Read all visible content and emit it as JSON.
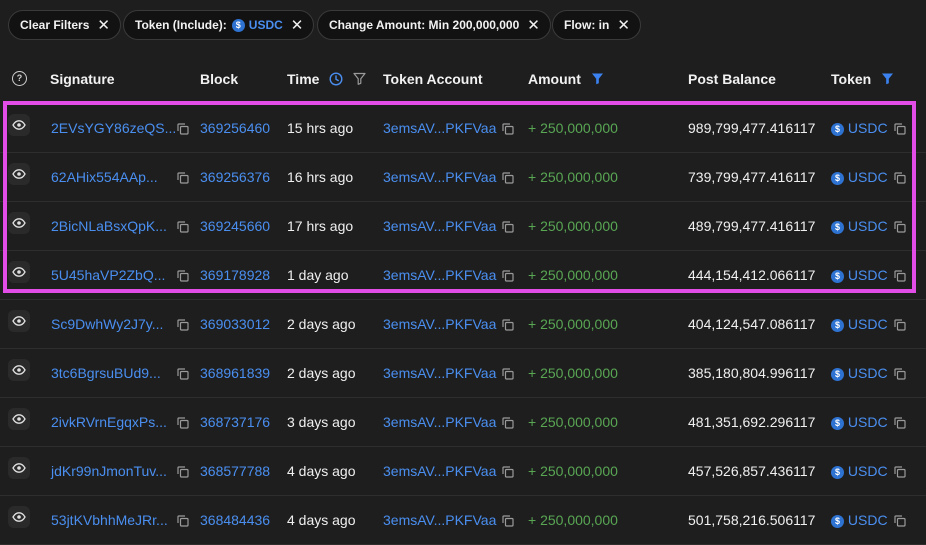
{
  "filters": {
    "clear": "Clear Filters",
    "token_label": "Token (Include):",
    "token_value": "USDC",
    "amount_label": "Change Amount: Min 200,000,000",
    "flow_label": "Flow: in",
    "close_glyph": "✕"
  },
  "columns": {
    "signature": "Signature",
    "block": "Block",
    "time": "Time",
    "token_account": "Token Account",
    "amount": "Amount",
    "post_balance": "Post Balance",
    "token": "Token"
  },
  "colors": {
    "link": "#4a8ff0",
    "positive": "#59a653",
    "highlight": "#e14de6",
    "background": "#1e1e1f"
  },
  "rows": [
    {
      "signature": "2EVsYGY86zeQS...",
      "block": "369256460",
      "time": "15 hrs ago",
      "account": "3emsAV...PKFVaa",
      "amount": "+ 250,000,000",
      "balance": "989,799,477.416117",
      "token": "USDC"
    },
    {
      "signature": "62AHix554AAp...",
      "block": "369256376",
      "time": "16 hrs ago",
      "account": "3emsAV...PKFVaa",
      "amount": "+ 250,000,000",
      "balance": "739,799,477.416117",
      "token": "USDC"
    },
    {
      "signature": "2BicNLaBsxQpK...",
      "block": "369245660",
      "time": "17 hrs ago",
      "account": "3emsAV...PKFVaa",
      "amount": "+ 250,000,000",
      "balance": "489,799,477.416117",
      "token": "USDC"
    },
    {
      "signature": "5U45haVP2ZbQ...",
      "block": "369178928",
      "time": "1 day ago",
      "account": "3emsAV...PKFVaa",
      "amount": "+ 250,000,000",
      "balance": "444,154,412.066117",
      "token": "USDC"
    },
    {
      "signature": "Sc9DwhWy2J7y...",
      "block": "369033012",
      "time": "2 days ago",
      "account": "3emsAV...PKFVaa",
      "amount": "+ 250,000,000",
      "balance": "404,124,547.086117",
      "token": "USDC"
    },
    {
      "signature": "3tc6BgrsuBUd9...",
      "block": "368961839",
      "time": "2 days ago",
      "account": "3emsAV...PKFVaa",
      "amount": "+ 250,000,000",
      "balance": "385,180,804.996117",
      "token": "USDC"
    },
    {
      "signature": "2ivkRVrnEgqxPs...",
      "block": "368737176",
      "time": "3 days ago",
      "account": "3emsAV...PKFVaa",
      "amount": "+ 250,000,000",
      "balance": "481,351,692.296117",
      "token": "USDC"
    },
    {
      "signature": "jdKr99nJmonTuv...",
      "block": "368577788",
      "time": "4 days ago",
      "account": "3emsAV...PKFVaa",
      "amount": "+ 250,000,000",
      "balance": "457,526,857.436117",
      "token": "USDC"
    },
    {
      "signature": "53jtKVbhhMeJRr...",
      "block": "368484436",
      "time": "4 days ago",
      "account": "3emsAV...PKFVaa",
      "amount": "+ 250,000,000",
      "balance": "501,758,216.506117",
      "token": "USDC"
    }
  ]
}
